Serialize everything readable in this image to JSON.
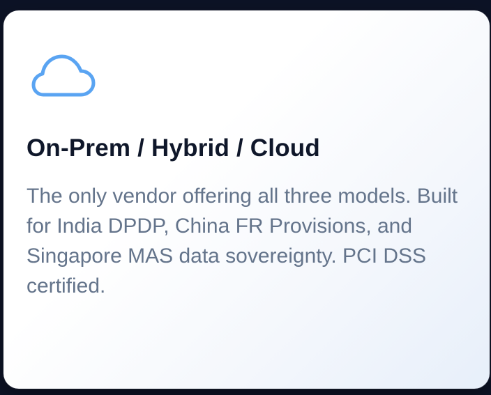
{
  "card": {
    "icon": "cloud-icon",
    "title": "On-Prem / Hybrid / Cloud",
    "description": "The only vendor offering all three models. Built for India DPDP, China FR Provisions, and Singapore MAS data sovereignty. PCI DSS certified."
  },
  "colors": {
    "icon_stroke": "#5aa4f2",
    "title": "#0f172a",
    "description": "#64748b",
    "page_background": "#0d1326"
  }
}
